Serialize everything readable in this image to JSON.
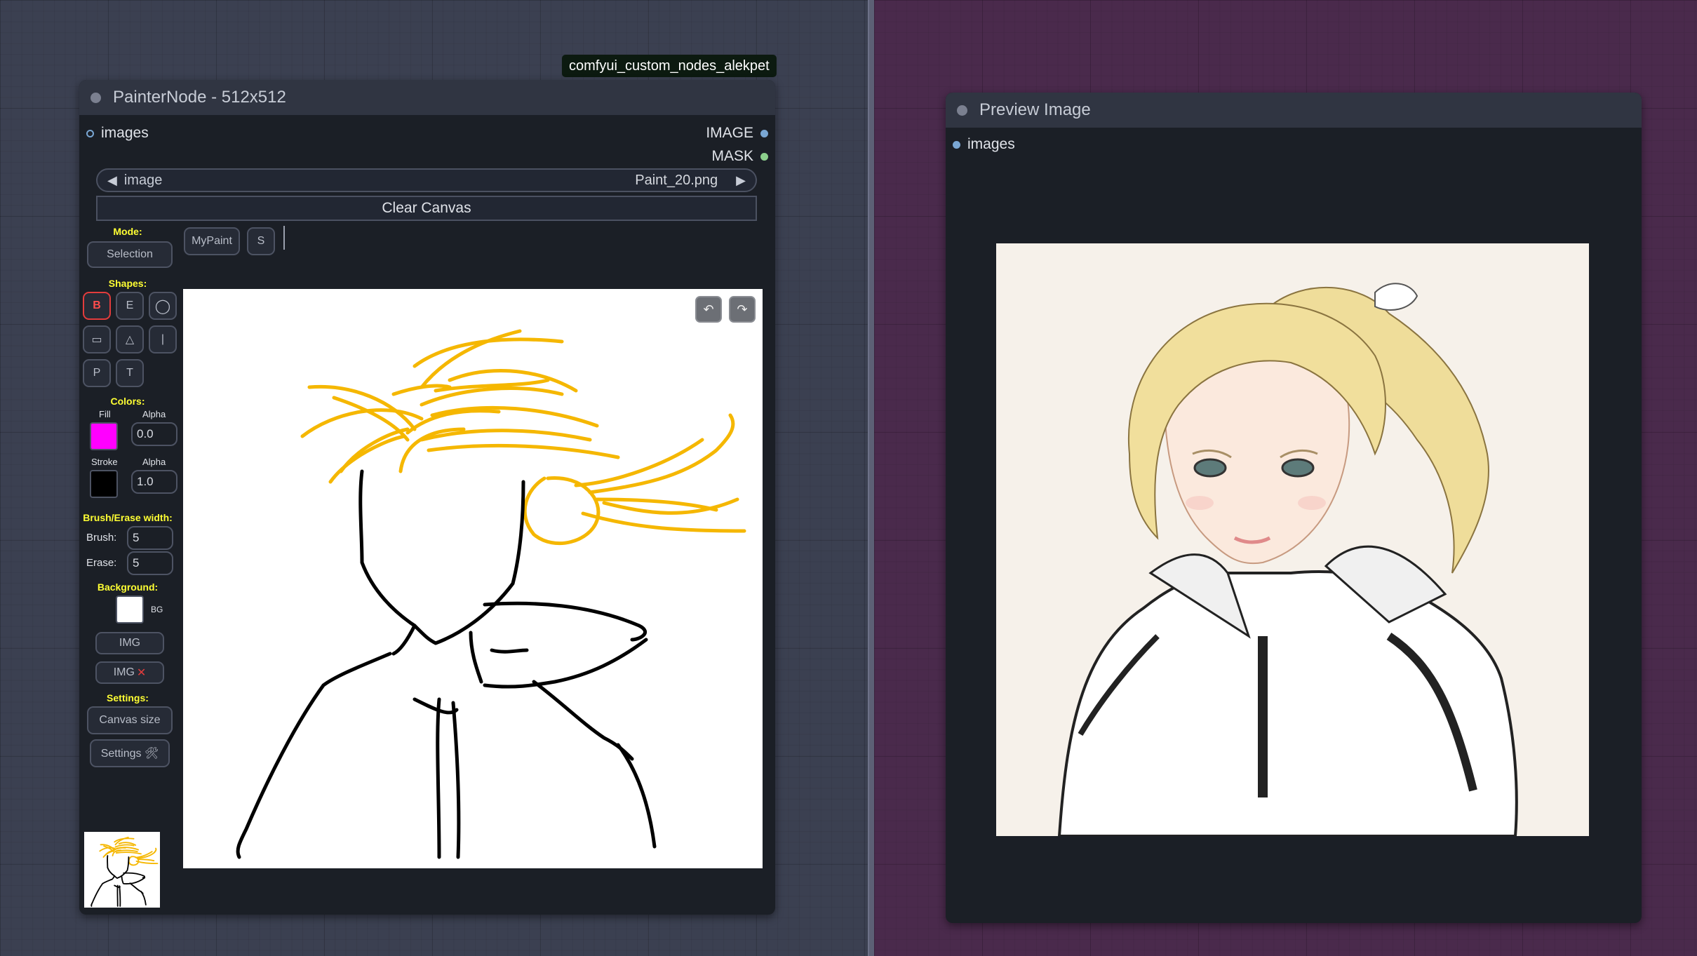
{
  "badge": "comfyui_custom_nodes_alekpet",
  "painter": {
    "title": "PainterNode - 512x512",
    "input_images": "images",
    "output_image": "IMAGE",
    "output_mask": "MASK",
    "combo_label": "image",
    "combo_value": "Paint_20.png",
    "clear_canvas": "Clear Canvas",
    "mode_label": "Mode:",
    "mode_selection": "Selection",
    "mypaint": "MyPaint",
    "s_button": "S",
    "shapes_label": "Shapes:",
    "shapes": [
      "B",
      "E",
      "◯",
      "▭",
      "△",
      "|",
      "P",
      "T"
    ],
    "active_shape": "B",
    "colors_label": "Colors:",
    "fill_label": "Fill",
    "alpha_label": "Alpha",
    "fill_color": "#ff00ff",
    "fill_alpha": "0.0",
    "stroke_label": "Stroke",
    "stroke_color": "#000000",
    "stroke_alpha": "1.0",
    "width_label": "Brush/Erase width:",
    "brush_label": "Brush:",
    "brush_value": "5",
    "erase_label": "Erase:",
    "erase_value": "5",
    "background_label": "Background:",
    "bg_label": "BG",
    "bg_color": "#ffffff",
    "img_button": "IMG",
    "img_remove_button": "IMG",
    "settings_label": "Settings:",
    "canvas_size": "Canvas size",
    "settings_button": "Settings 🛠",
    "undo": "↶",
    "redo": "↷",
    "stroke_colors": {
      "hair": "#f5b700",
      "outline": "#000000"
    }
  },
  "preview": {
    "title": "Preview Image",
    "input_images": "images"
  },
  "colors": {
    "graph_left": "#3b4051",
    "graph_right": "#4a2a4c",
    "node_body": "#1b1f26",
    "node_title": "#303542",
    "label_yellow": "#ffff33",
    "slot_image": "#7aa7d4",
    "slot_mask": "#8ccf8c"
  }
}
